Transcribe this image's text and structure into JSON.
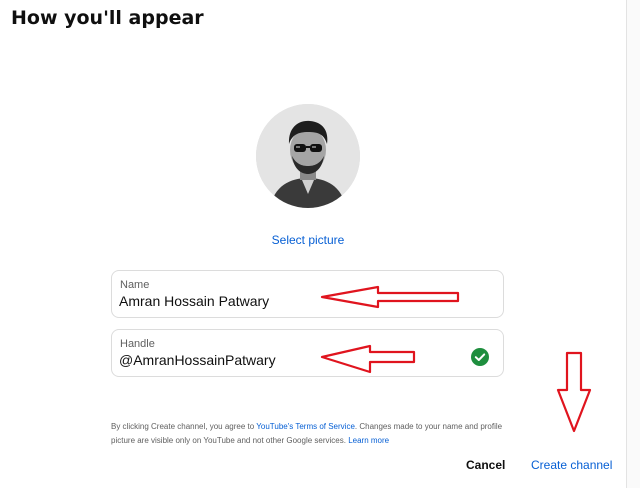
{
  "dialog": {
    "title": "How you'll appear"
  },
  "avatar": {
    "icon": "profile-picture"
  },
  "select_picture_label": "Select picture",
  "fields": {
    "name": {
      "label": "Name",
      "value": "Amran Hossain Patwary"
    },
    "handle": {
      "label": "Handle",
      "value": "@AmranHossainPatwary",
      "status_icon": "check-circle-icon",
      "status_color": "#1e8e3e"
    }
  },
  "disclaimer": {
    "prefix": "By clicking Create channel, you agree to ",
    "terms_link": "YouTube's Terms of Service",
    "middle": ". Changes made to your name and profile picture are visible only on YouTube and not other Google services. ",
    "learn_more": "Learn more"
  },
  "buttons": {
    "cancel": "Cancel",
    "create": "Create channel"
  },
  "colors": {
    "accent": "#065fd4",
    "annotation": "#e0141e"
  }
}
